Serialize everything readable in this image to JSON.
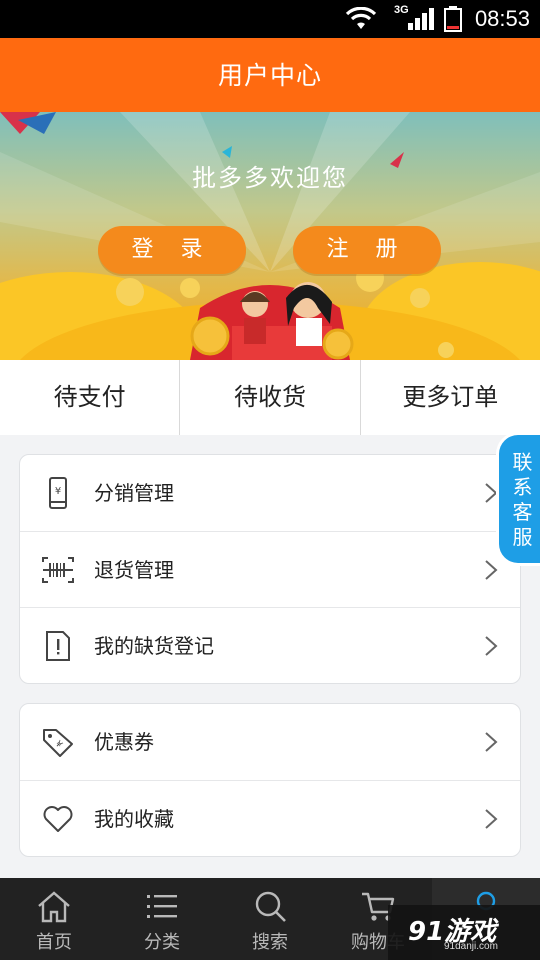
{
  "status_bar": {
    "time": "08:53",
    "network": "3G"
  },
  "header": {
    "title": "用户中心"
  },
  "banner": {
    "welcome_text": "批多多欢迎您",
    "login_label": "登 录",
    "register_label": "注 册"
  },
  "orders": {
    "tabs": [
      {
        "label": "待支付"
      },
      {
        "label": "待收货"
      },
      {
        "label": "更多订单"
      }
    ]
  },
  "menu": {
    "group1": [
      {
        "label": "分销管理",
        "icon": "phone-yen-icon"
      },
      {
        "label": "退货管理",
        "icon": "barcode-icon"
      },
      {
        "label": "我的缺货登记",
        "icon": "document-alert-icon"
      }
    ],
    "group2": [
      {
        "label": "优惠券",
        "icon": "coupon-tag-icon"
      },
      {
        "label": "我的收藏",
        "icon": "heart-icon"
      }
    ]
  },
  "service_tab": {
    "chars": [
      "联",
      "系",
      "客",
      "服"
    ]
  },
  "bottom_nav": {
    "items": [
      {
        "label": "首页",
        "icon": "home-icon"
      },
      {
        "label": "分类",
        "icon": "list-icon"
      },
      {
        "label": "搜索",
        "icon": "search-icon"
      },
      {
        "label": "购物车",
        "icon": "cart-icon"
      }
    ]
  },
  "watermark": {
    "logo": "91游戏",
    "url": "91danji.com"
  },
  "colors": {
    "accent": "#ff6a10",
    "button": "#f48a1c",
    "service": "#1e9ee6",
    "nav_bg": "#222222"
  }
}
